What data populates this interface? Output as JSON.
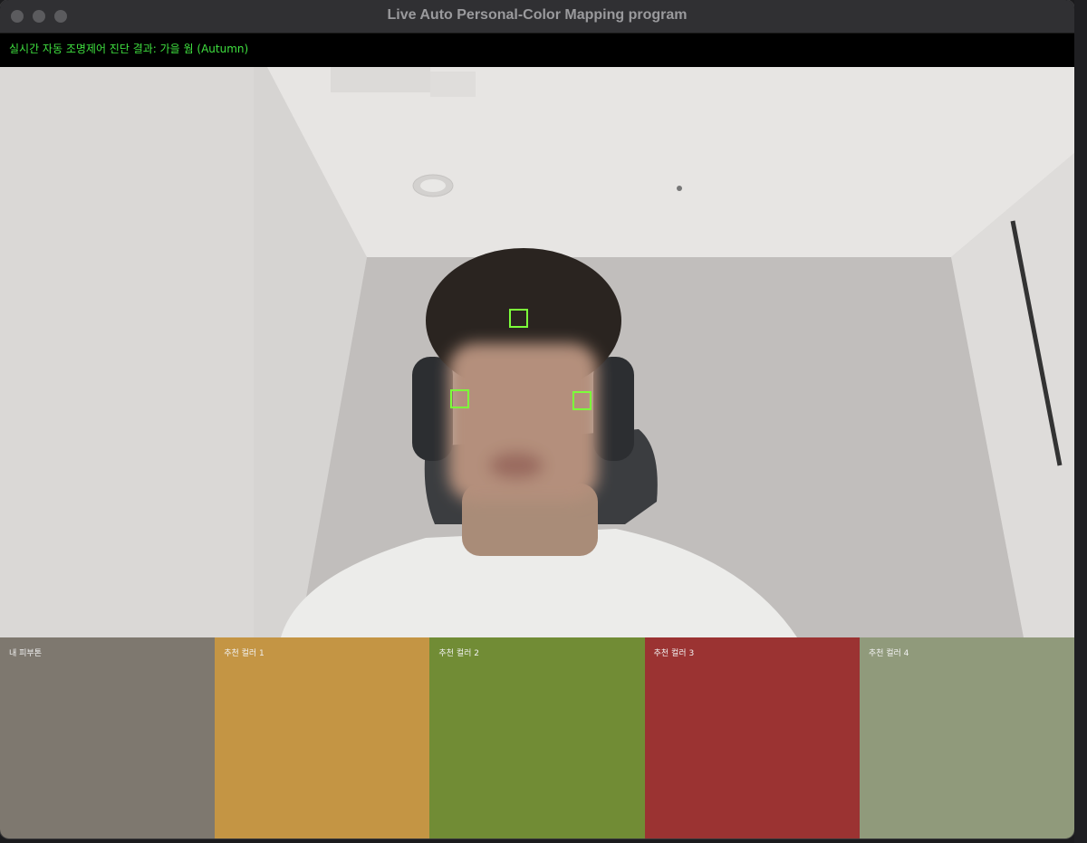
{
  "window": {
    "title": "Live Auto Personal-Color Mapping program"
  },
  "status": {
    "text": "실시간 자동 조명제어 진단 결과: 가을 웜 (Autumn)",
    "color": "#3fe03f"
  },
  "camera": {
    "icons": [
      "face-region-marker-icon",
      "face-region-marker-icon",
      "face-region-marker-icon"
    ]
  },
  "swatches": [
    {
      "label": "내 피부톤",
      "color": "#7e786f"
    },
    {
      "label": "추천 컬러 1",
      "color": "#c49544"
    },
    {
      "label": "추천 컬러 2",
      "color": "#718c35"
    },
    {
      "label": "추천 컬러 3",
      "color": "#9b3332"
    },
    {
      "label": "추천 컬러 4",
      "color": "#909a7b"
    }
  ]
}
